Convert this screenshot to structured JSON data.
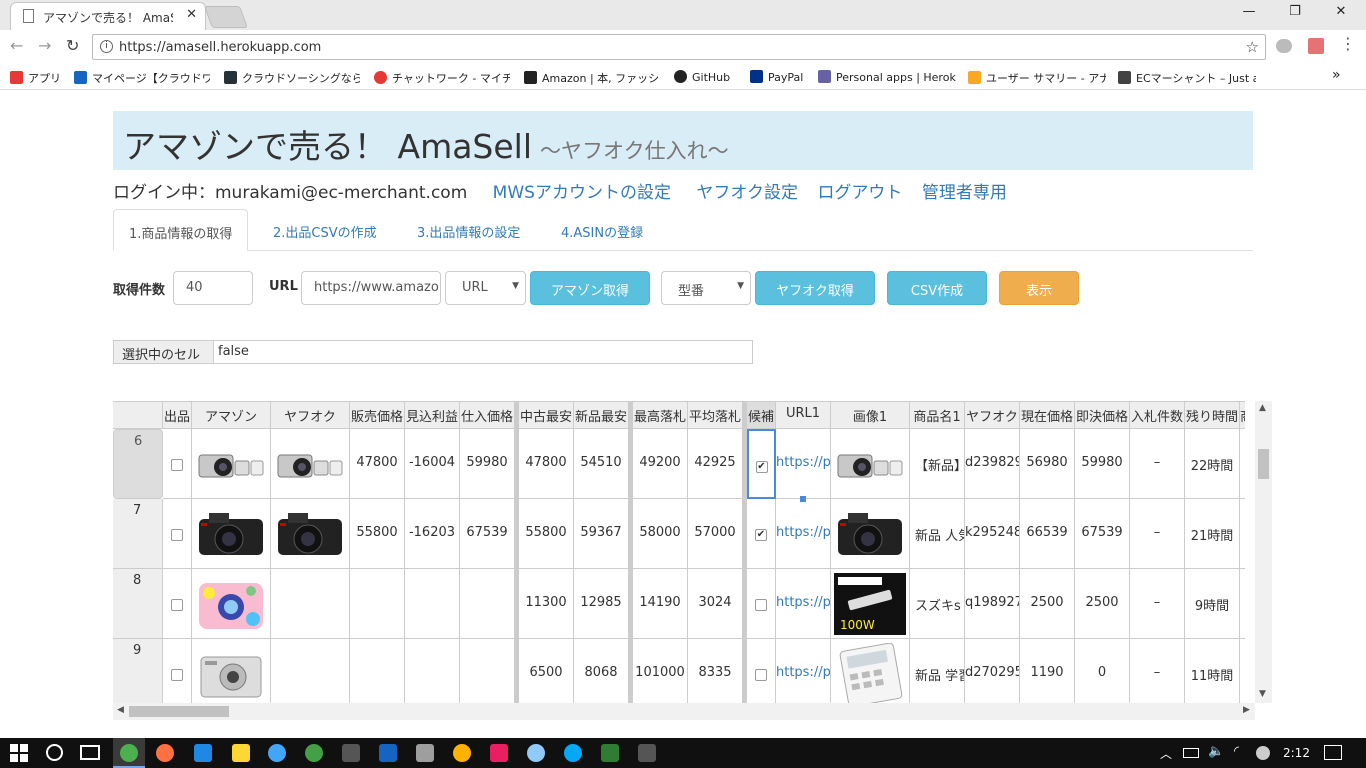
{
  "browser": {
    "tab_title": "アマゾンで売る！ AmaSell",
    "tab_close": "✕",
    "url": "https://amasell.herokuapp.com",
    "win_min": "—",
    "win_max": "❐",
    "win_close": "✕",
    "bookmarks": [
      {
        "label": "アプリ",
        "color": "#e53935"
      },
      {
        "label": "マイページ【クラウドワーク",
        "color": "#1565c0"
      },
      {
        "label": "クラウドソーシングなら日",
        "color": "#263238"
      },
      {
        "label": "チャットワーク - マイチャッ",
        "color": "#e53935"
      },
      {
        "label": "Amazon | 本, ファッショ",
        "color": "#222222"
      },
      {
        "label": "GitHub",
        "color": "#222222"
      },
      {
        "label": "PayPal",
        "color": "#003087"
      },
      {
        "label": "Personal apps | Herok",
        "color": "#6762a6"
      },
      {
        "label": "ユーザー サマリー - アナリ",
        "color": "#f9a825"
      },
      {
        "label": "ECマーシャント – Just an",
        "color": "#424242"
      }
    ],
    "more": "»"
  },
  "page": {
    "title": "アマゾンで売る！ AmaSell",
    "subtitle": "〜ヤフオク仕入れ〜",
    "login": "ログイン中：murakami@ec-merchant.com",
    "nav": [
      "MWSアカウントの設定",
      "ヤフオク設定",
      "ログアウト",
      "管理者専用"
    ],
    "tabs": [
      "1.商品情報の取得",
      "2.出品CSVの作成",
      "3.出品情報の設定",
      "4.ASINの登録"
    ],
    "form": {
      "count_label": "取得件数",
      "count_value": "40",
      "url_label": "URL",
      "url_value": "https://www.amazo",
      "url_select": "URL",
      "amazon_btn": "アマゾン取得",
      "model_select": "型番",
      "yahoo_btn": "ヤフオク取得",
      "csv_btn": "CSV作成",
      "show_btn": "表示"
    },
    "selected_cell_label": "選択中のセル",
    "selected_cell_value": "false"
  },
  "grid": {
    "headers": [
      "出品",
      "アマゾン",
      "ヤフオク",
      "販売価格",
      "見込利益",
      "仕入価格",
      "中古最安",
      "新品最安",
      "最高落札",
      "平均落札",
      "候補",
      "URL1",
      "画像1",
      "商品名1",
      "ヤフオク",
      "現在価格",
      "即決価格",
      "入札件数",
      "残り時間",
      "商"
    ],
    "rows": [
      {
        "num": "6",
        "sell": false,
        "amazon_img": "camera-mirrorless",
        "yahoo_img": "camera-mirrorless",
        "price": "47800",
        "profit": "-16004",
        "cost": "59980",
        "used": "47800",
        "new": "54510",
        "max": "49200",
        "avg": "42925",
        "cand": true,
        "url": "https://p",
        "img1": "camera-mirrorless",
        "name": "【新品】",
        "yid": "d239829",
        "cur": "56980",
        "buy": "59980",
        "bids": "–",
        "left": "22時間"
      },
      {
        "num": "7",
        "sell": false,
        "amazon_img": "camera-dslr",
        "yahoo_img": "camera-dslr",
        "price": "55800",
        "profit": "-16203",
        "cost": "67539",
        "used": "55800",
        "new": "59367",
        "max": "58000",
        "avg": "57000",
        "cand": true,
        "url": "https://p",
        "img1": "camera-dslr",
        "name": "新品 人気",
        "yid": "k295248",
        "cur": "66539",
        "buy": "67539",
        "bids": "–",
        "left": "21時間"
      },
      {
        "num": "8",
        "sell": false,
        "amazon_img": "camera-floral",
        "yahoo_img": "",
        "price": "",
        "profit": "",
        "cost": "",
        "used": "11300",
        "new": "12985",
        "max": "14190",
        "avg": "3024",
        "cand": false,
        "url": "https://p",
        "img1": "led-lamp",
        "name": "スズキs",
        "yid": "q198927",
        "cur": "2500",
        "buy": "2500",
        "bids": "–",
        "left": "9時間"
      },
      {
        "num": "9",
        "sell": false,
        "amazon_img": "camera-compact",
        "yahoo_img": "",
        "price": "",
        "profit": "",
        "cost": "",
        "used": "6500",
        "new": "8068",
        "max": "101000",
        "avg": "8335",
        "cand": false,
        "url": "https://p",
        "img1": "calculator",
        "name": "新品 学習",
        "yid": "d270295",
        "cur": "1190",
        "buy": "0",
        "bids": "–",
        "left": "11時間"
      }
    ]
  },
  "taskbar": {
    "time": "2:12"
  }
}
